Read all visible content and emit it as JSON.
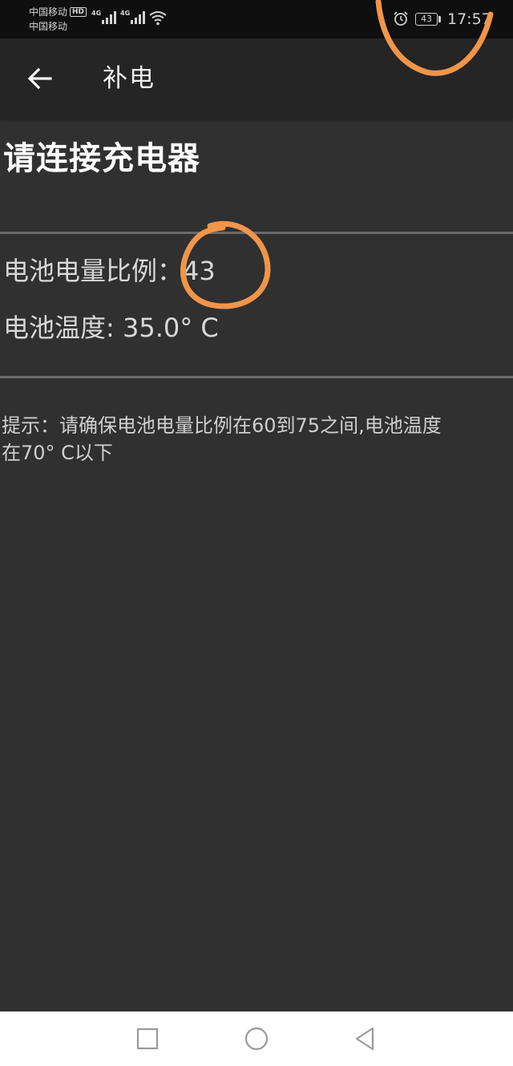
{
  "status_bar": {
    "carrier_1": "中国移动",
    "hd_badge": "HD",
    "carrier_2": "中国移动",
    "network_1": "4G",
    "network_2": "4G",
    "battery_level": "43",
    "time": "17:57"
  },
  "toolbar": {
    "back_icon": "arrow-left-icon",
    "title": "补电"
  },
  "main": {
    "headline": "请连接充电器",
    "battery_ratio_label": "电池电量比例：",
    "battery_ratio_value": "43",
    "battery_temp_label": "电池温度: ",
    "battery_temp_value": "35.0° C",
    "hint_line_1": "提示：请确保电池电量比例在60到75之间,电池温度",
    "hint_line_2": "在70° C以下"
  },
  "nav_bar": {
    "recents_icon": "square-icon",
    "home_icon": "circle-icon",
    "back_icon": "triangle-back-icon"
  },
  "colors": {
    "background": "#303030",
    "toolbar": "#252525",
    "status_bar": "#0f0f0f",
    "annotation": "#f0954a"
  }
}
